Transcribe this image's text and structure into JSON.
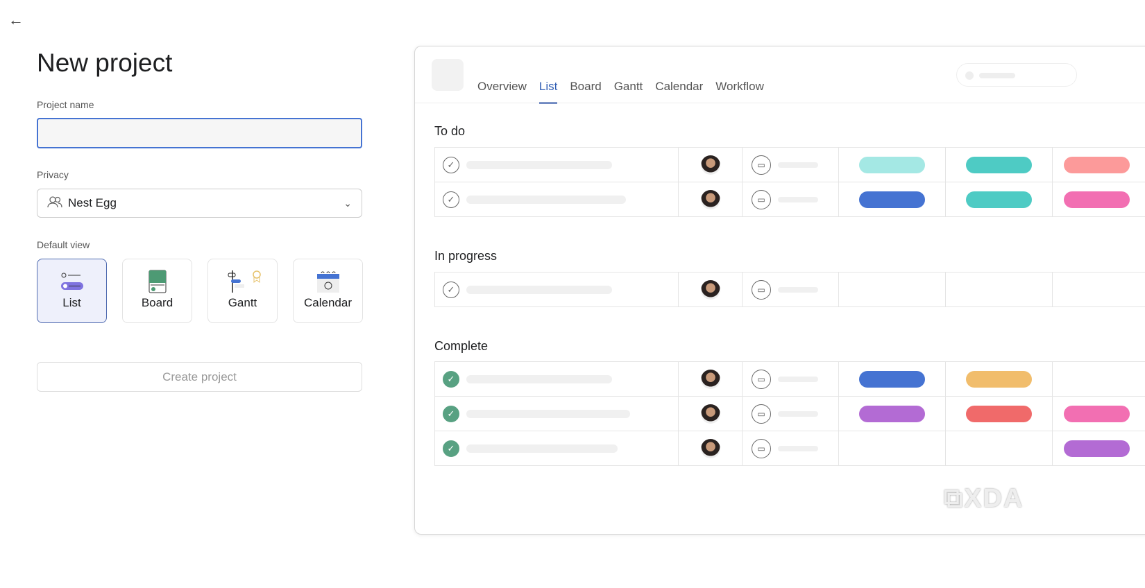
{
  "page": {
    "title": "New project",
    "back_icon": "←"
  },
  "form": {
    "project_name_label": "Project name",
    "project_name_value": "",
    "project_name_placeholder": "",
    "privacy_label": "Privacy",
    "privacy_value": "Nest Egg",
    "default_view_label": "Default view",
    "views": [
      {
        "label": "List",
        "selected": true
      },
      {
        "label": "Board",
        "selected": false
      },
      {
        "label": "Gantt",
        "selected": false
      },
      {
        "label": "Calendar",
        "selected": false
      }
    ],
    "create_label": "Create project"
  },
  "preview": {
    "tabs": [
      {
        "label": "Overview"
      },
      {
        "label": "List",
        "active": true
      },
      {
        "label": "Board"
      },
      {
        "label": "Gantt"
      },
      {
        "label": "Calendar"
      },
      {
        "label": "Workflow"
      }
    ],
    "sections": [
      {
        "title": "To do",
        "rows": [
          {
            "done": false,
            "pills": [
              "#a4e8e4",
              "#4ecbc4",
              "#fc9a9a"
            ]
          },
          {
            "done": false,
            "pills": [
              "#4573d2",
              "#4ecbc4",
              "#f26fb2"
            ]
          }
        ]
      },
      {
        "title": "In progress",
        "rows": [
          {
            "done": false,
            "pills": [
              null,
              null,
              null
            ]
          }
        ]
      },
      {
        "title": "Complete",
        "rows": [
          {
            "done": true,
            "pills": [
              "#4573d2",
              "#f1bd6c",
              null
            ]
          },
          {
            "done": true,
            "pills": [
              "#b36bd4",
              "#f06a6a",
              "#f26fb2"
            ]
          },
          {
            "done": true,
            "pills": [
              null,
              null,
              "#b36bd4"
            ]
          }
        ]
      }
    ]
  },
  "watermark": "XDA"
}
